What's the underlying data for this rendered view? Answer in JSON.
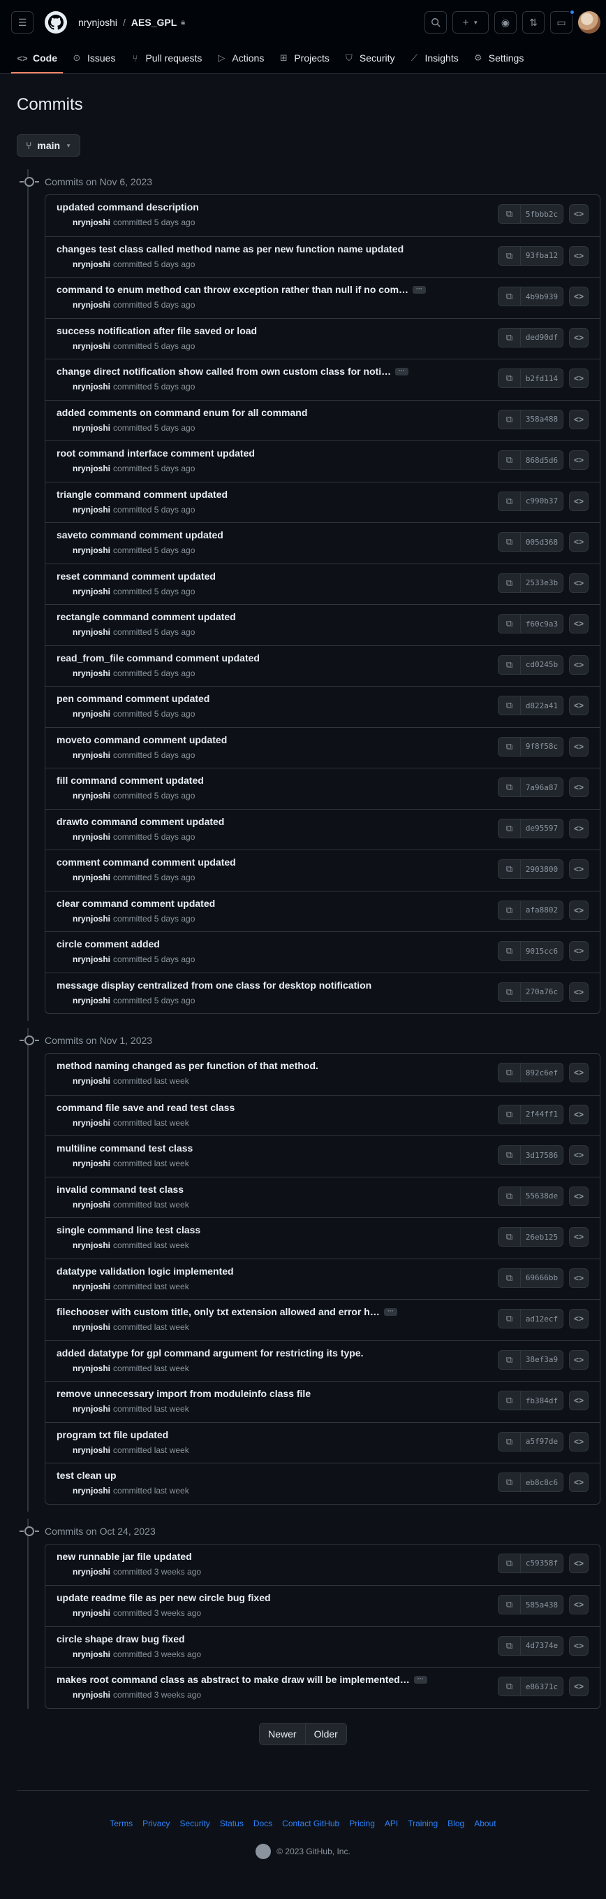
{
  "header": {
    "owner": "nrynjoshi",
    "separator": "/",
    "repo": "AES_GPL",
    "plus": "+"
  },
  "nav": [
    {
      "label": "Code",
      "icon": "code-icon"
    },
    {
      "label": "Issues",
      "icon": "issue-icon"
    },
    {
      "label": "Pull requests",
      "icon": "pull-request-icon"
    },
    {
      "label": "Actions",
      "icon": "play-icon"
    },
    {
      "label": "Projects",
      "icon": "table-icon"
    },
    {
      "label": "Security",
      "icon": "shield-icon"
    },
    {
      "label": "Insights",
      "icon": "graph-icon"
    },
    {
      "label": "Settings",
      "icon": "gear-icon"
    }
  ],
  "page": {
    "title": "Commits",
    "branch": "main"
  },
  "groups": [
    {
      "heading": "Commits on Nov 6, 2023",
      "commits": [
        {
          "message": "updated command description",
          "author": "nrynjoshi",
          "time": "committed 5 days ago",
          "sha": "5fbbb2c",
          "more": false
        },
        {
          "message": "changes test class called method name as per new function name updated",
          "author": "nrynjoshi",
          "time": "committed 5 days ago",
          "sha": "93fba12",
          "more": false
        },
        {
          "message": "command to enum method can throw exception rather than null if no com…",
          "author": "nrynjoshi",
          "time": "committed 5 days ago",
          "sha": "4b9b939",
          "more": true
        },
        {
          "message": "success notification after file saved or load",
          "author": "nrynjoshi",
          "time": "committed 5 days ago",
          "sha": "ded90df",
          "more": false
        },
        {
          "message": "change direct notification show called from own custom class for noti…",
          "author": "nrynjoshi",
          "time": "committed 5 days ago",
          "sha": "b2fd114",
          "more": true
        },
        {
          "message": "added comments on command enum for all command",
          "author": "nrynjoshi",
          "time": "committed 5 days ago",
          "sha": "358a488",
          "more": false
        },
        {
          "message": "root command interface comment updated",
          "author": "nrynjoshi",
          "time": "committed 5 days ago",
          "sha": "868d5d6",
          "more": false
        },
        {
          "message": "triangle command comment updated",
          "author": "nrynjoshi",
          "time": "committed 5 days ago",
          "sha": "c990b37",
          "more": false
        },
        {
          "message": "saveto command comment updated",
          "author": "nrynjoshi",
          "time": "committed 5 days ago",
          "sha": "005d368",
          "more": false
        },
        {
          "message": "reset command comment updated",
          "author": "nrynjoshi",
          "time": "committed 5 days ago",
          "sha": "2533e3b",
          "more": false
        },
        {
          "message": "rectangle command comment updated",
          "author": "nrynjoshi",
          "time": "committed 5 days ago",
          "sha": "f60c9a3",
          "more": false
        },
        {
          "message": "read_from_file command comment updated",
          "author": "nrynjoshi",
          "time": "committed 5 days ago",
          "sha": "cd0245b",
          "more": false
        },
        {
          "message": "pen command comment updated",
          "author": "nrynjoshi",
          "time": "committed 5 days ago",
          "sha": "d822a41",
          "more": false
        },
        {
          "message": "moveto command comment updated",
          "author": "nrynjoshi",
          "time": "committed 5 days ago",
          "sha": "9f8f58c",
          "more": false
        },
        {
          "message": "fill command comment updated",
          "author": "nrynjoshi",
          "time": "committed 5 days ago",
          "sha": "7a96a87",
          "more": false
        },
        {
          "message": "drawto command comment updated",
          "author": "nrynjoshi",
          "time": "committed 5 days ago",
          "sha": "de95597",
          "more": false
        },
        {
          "message": "comment command comment updated",
          "author": "nrynjoshi",
          "time": "committed 5 days ago",
          "sha": "2903800",
          "more": false
        },
        {
          "message": "clear command comment updated",
          "author": "nrynjoshi",
          "time": "committed 5 days ago",
          "sha": "afa8802",
          "more": false
        },
        {
          "message": "circle comment added",
          "author": "nrynjoshi",
          "time": "committed 5 days ago",
          "sha": "9015cc6",
          "more": false
        },
        {
          "message": "message display centralized from one class for desktop notification",
          "author": "nrynjoshi",
          "time": "committed 5 days ago",
          "sha": "270a76c",
          "more": false
        }
      ]
    },
    {
      "heading": "Commits on Nov 1, 2023",
      "commits": [
        {
          "message": "method naming changed as per function of that method.",
          "author": "nrynjoshi",
          "time": "committed last week",
          "sha": "892c6ef",
          "more": false
        },
        {
          "message": "command file save and read test class",
          "author": "nrynjoshi",
          "time": "committed last week",
          "sha": "2f44ff1",
          "more": false
        },
        {
          "message": "multiline command test class",
          "author": "nrynjoshi",
          "time": "committed last week",
          "sha": "3d17586",
          "more": false
        },
        {
          "message": "invalid command test class",
          "author": "nrynjoshi",
          "time": "committed last week",
          "sha": "55638de",
          "more": false
        },
        {
          "message": "single command line test class",
          "author": "nrynjoshi",
          "time": "committed last week",
          "sha": "26eb125",
          "more": false
        },
        {
          "message": "datatype validation logic implemented",
          "author": "nrynjoshi",
          "time": "committed last week",
          "sha": "69666bb",
          "more": false
        },
        {
          "message": "filechooser with custom title, only txt extension allowed and error h…",
          "author": "nrynjoshi",
          "time": "committed last week",
          "sha": "ad12ecf",
          "more": true
        },
        {
          "message": "added datatype for gpl command argument for restricting its type.",
          "author": "nrynjoshi",
          "time": "committed last week",
          "sha": "38ef3a9",
          "more": false
        },
        {
          "message": "remove unnecessary import from moduleinfo class file",
          "author": "nrynjoshi",
          "time": "committed last week",
          "sha": "fb384df",
          "more": false
        },
        {
          "message": "program txt file updated",
          "author": "nrynjoshi",
          "time": "committed last week",
          "sha": "a5f97de",
          "more": false
        },
        {
          "message": "test clean up",
          "author": "nrynjoshi",
          "time": "committed last week",
          "sha": "eb8c8c6",
          "more": false
        }
      ]
    },
    {
      "heading": "Commits on Oct 24, 2023",
      "commits": [
        {
          "message": "new runnable jar file updated",
          "author": "nrynjoshi",
          "time": "committed 3 weeks ago",
          "sha": "c59358f",
          "more": false
        },
        {
          "message": "update readme file as per new circle bug fixed",
          "author": "nrynjoshi",
          "time": "committed 3 weeks ago",
          "sha": "585a438",
          "more": false
        },
        {
          "message": "circle shape draw bug fixed",
          "author": "nrynjoshi",
          "time": "committed 3 weeks ago",
          "sha": "4d7374e",
          "more": false
        },
        {
          "message": "makes root command class as abstract to make draw will be implemented…",
          "author": "nrynjoshi",
          "time": "committed 3 weeks ago",
          "sha": "e86371c",
          "more": true
        }
      ]
    }
  ],
  "pagination": {
    "newer": "Newer",
    "older": "Older"
  },
  "footer": {
    "links": [
      "Terms",
      "Privacy",
      "Security",
      "Status",
      "Docs",
      "Contact GitHub",
      "Pricing",
      "API",
      "Training",
      "Blog",
      "About"
    ],
    "copyright": "© 2023 GitHub, Inc."
  },
  "colors": {
    "accent": "#2f81f7",
    "tab_underline": "#f78166",
    "background": "#0d1117"
  }
}
